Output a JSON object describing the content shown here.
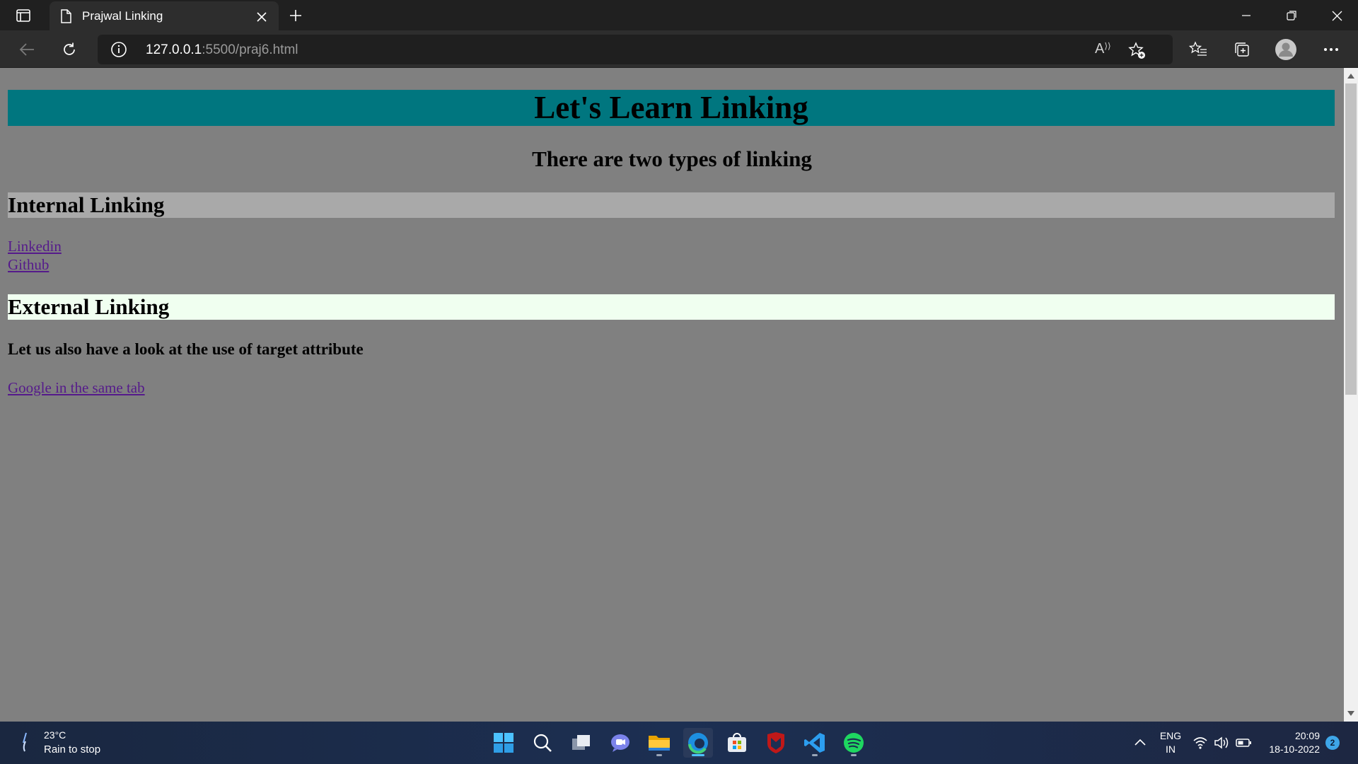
{
  "browser": {
    "tab_title": "Prajwal Linking",
    "url_host": "127.0.0.1",
    "url_path": ":5500/praj6.html",
    "read_aloud_label": "A͈"
  },
  "page": {
    "heading": "Let's Learn Linking",
    "subheading": "There are two types of linking",
    "internal_heading": "Internal Linking",
    "links_internal": [
      "Linkedin",
      "Github"
    ],
    "external_heading": "External Linking",
    "target_heading": "Let us also have a look at the use of target attribute",
    "link_google": "Google in the same tab",
    "colors": {
      "heading_bg": "#00767f",
      "internal_bg": "#a9a9a9",
      "external_bg": "#f0fff0",
      "page_bg": "#808080",
      "link": "#551a8b"
    }
  },
  "taskbar": {
    "weather_temp": "23°C",
    "weather_desc": "Rain to stop",
    "lang_line1": "ENG",
    "lang_line2": "IN",
    "time": "20:09",
    "date": "18-10-2022",
    "notification_count": "2",
    "apps": [
      "start-icon",
      "search-icon",
      "task-view-icon",
      "teams-chat-icon",
      "file-explorer-icon",
      "edge-icon",
      "store-icon",
      "mcafee-icon",
      "vscode-icon",
      "spotify-icon"
    ]
  }
}
